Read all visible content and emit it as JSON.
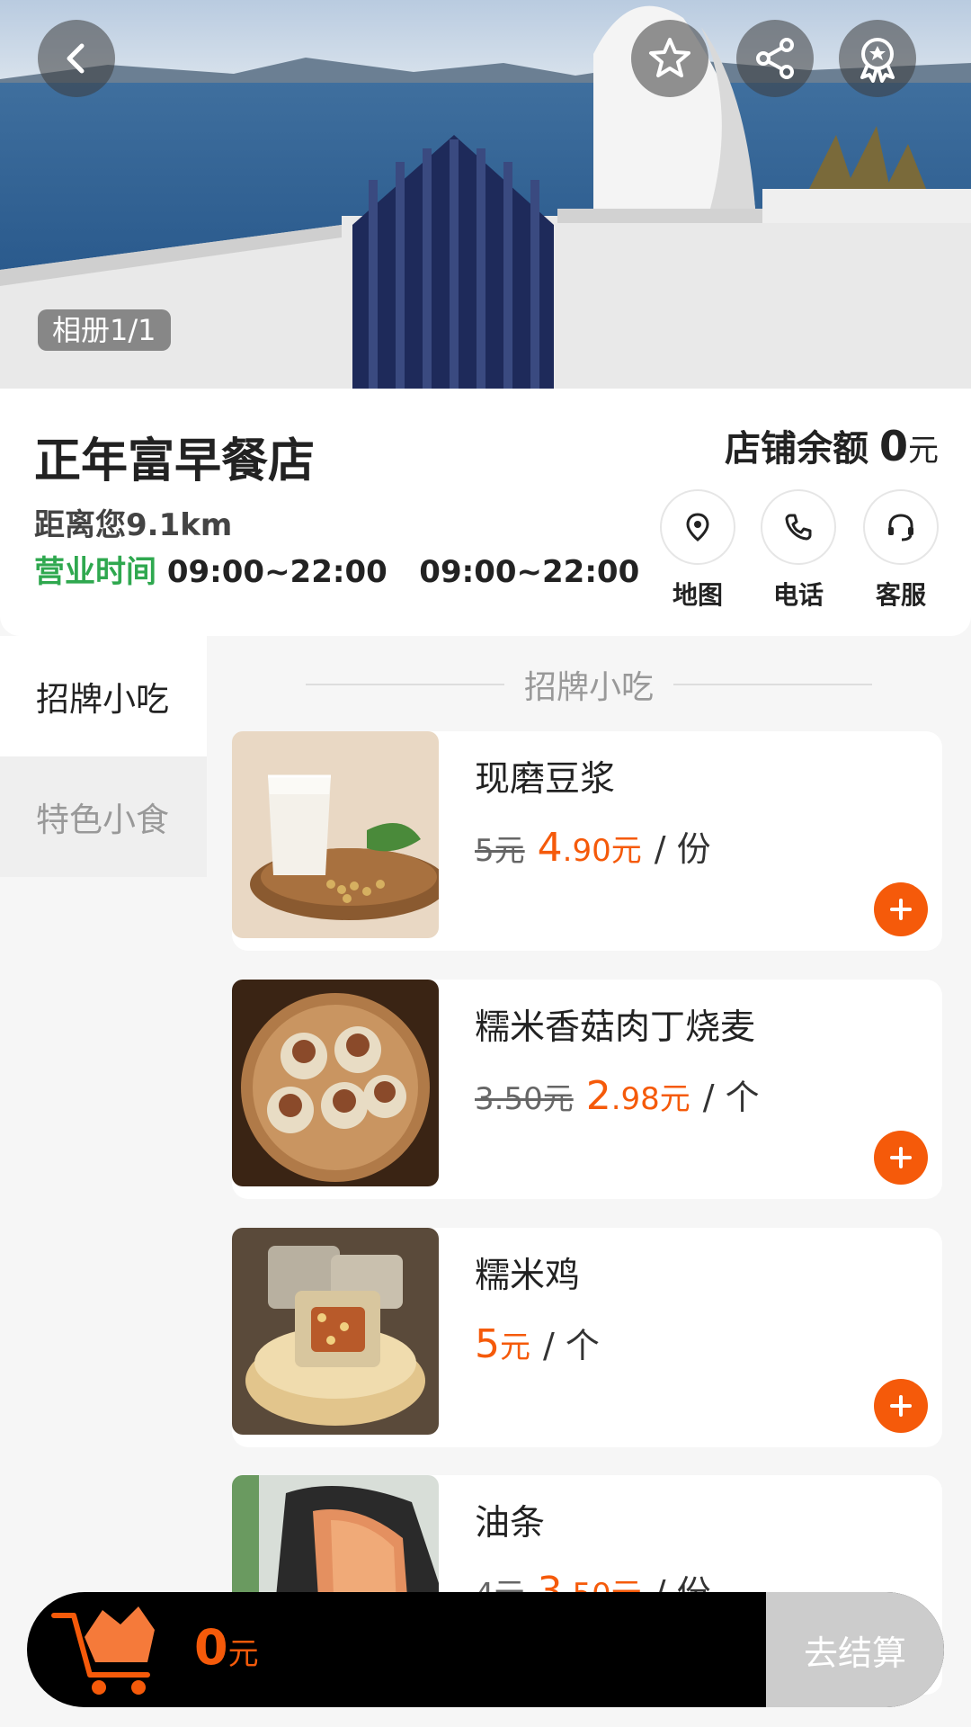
{
  "header": {
    "album_label": "相册1/1"
  },
  "store": {
    "name": "正年富早餐店",
    "distance": "距离您9.1km",
    "hours_label": "营业时间",
    "hours_value": "09:00~22:00   09:00~22:00",
    "balance_label": "店铺余额",
    "balance_value": "0",
    "balance_unit": "元",
    "actions": {
      "map": "地图",
      "phone": "电话",
      "service": "客服"
    }
  },
  "sidebar": {
    "items": [
      {
        "label": "招牌小吃",
        "active": true
      },
      {
        "label": "特色小食",
        "active": false
      }
    ]
  },
  "menu": {
    "section_title": "招牌小吃",
    "items": [
      {
        "name": "现磨豆浆",
        "old_price": "5元",
        "price_int": "4",
        "price_dec": ".90元",
        "unit": "/ 份"
      },
      {
        "name": "糯米香菇肉丁烧麦",
        "old_price": "3.50元",
        "price_int": "2",
        "price_dec": ".98元",
        "unit": "/ 个"
      },
      {
        "name": "糯米鸡",
        "old_price": "",
        "price_int": "5",
        "price_dec": "元",
        "unit": "/ 个"
      },
      {
        "name": "油条",
        "old_price": "4元",
        "price_int": "3",
        "price_dec": ".50元",
        "unit": "/ 份"
      }
    ]
  },
  "cart": {
    "total_value": "0",
    "total_unit": "元",
    "checkout_label": "去结算"
  },
  "colors": {
    "accent": "#f55a0a",
    "hours_green": "#2fa84f",
    "checkout_disabled": "#cccccc"
  }
}
